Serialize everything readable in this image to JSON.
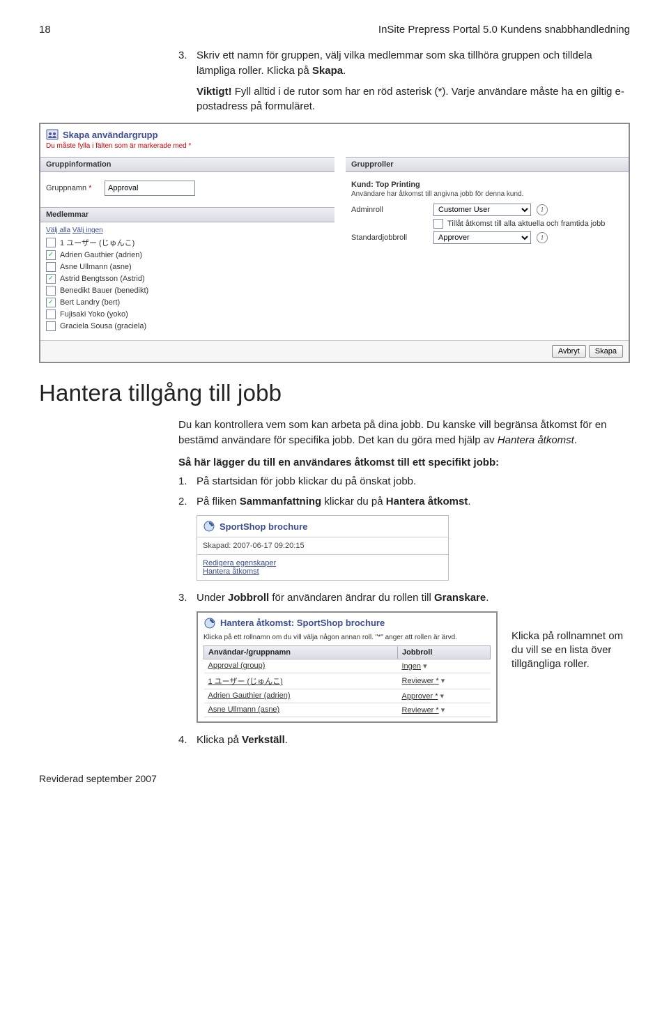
{
  "header": {
    "page_no": "18",
    "doc_title": "InSite Prepress Portal 5.0 Kundens snabbhandledning"
  },
  "intro": {
    "step3_num": "3.",
    "step3_text_a": "Skriv ett namn för gruppen, välj vilka medlemmar som ska tillhöra gruppen och tilldela lämpliga roller. Klicka på ",
    "step3_text_bold": "Skapa",
    "step3_text_b": ".",
    "viktigt_label": "Viktigt!",
    "viktigt_text": " Fyll alltid i de rutor som har en röd asterisk (*). Varje användare måste ha en giltig e-postadress på formuläret."
  },
  "panel1": {
    "title": "Skapa användargrupp",
    "required": "Du måste fylla i fälten som är markerade med *",
    "sec_gruppinfo": "Gruppinformation",
    "sec_grupproller": "Grupproller",
    "gruppnamn_label": "Gruppnamn",
    "gruppnamn_value": "Approval",
    "medlemmar_label": "Medlemmar",
    "valj_alla": "Välj alla",
    "valj_ingen": "Välj ingen",
    "members": [
      {
        "chk": false,
        "name": "1 ユーザー (じゅんこ)"
      },
      {
        "chk": true,
        "name": "Adrien Gauthier (adrien)"
      },
      {
        "chk": false,
        "name": "Asne Ullmann (asne)"
      },
      {
        "chk": true,
        "name": "Astrid Bengtsson (Astrid)"
      },
      {
        "chk": false,
        "name": "Benedikt Bauer (benedikt)"
      },
      {
        "chk": true,
        "name": "Bert Landry (bert)"
      },
      {
        "chk": false,
        "name": "Fujisaki Yoko (yoko)"
      },
      {
        "chk": false,
        "name": "Graciela Sousa (graciela)"
      }
    ],
    "kund_label": "Kund: Top Printing",
    "kund_note": "Användare har åtkomst till angivna jobb för denna kund.",
    "adminroll_label": "Adminroll",
    "adminroll_value": "Customer User",
    "tillat_label": "Tillåt åtkomst till alla aktuella och framtida jobb",
    "stdjobbroll_label": "Standardjobbroll",
    "stdjobbroll_value": "Approver",
    "btn_cancel": "Avbryt",
    "btn_create": "Skapa"
  },
  "section": {
    "heading": "Hantera tillgång till jobb",
    "p1_a": "Du kan kontrollera vem som kan arbeta på dina jobb. Du kanske vill begränsa åtkomst för en bestämd användare för specifika jobb. Det kan du göra med hjälp av ",
    "p1_italic": "Hantera åtkomst",
    "p1_b": ".",
    "howto": "Så här lägger du till en användares åtkomst till ett specifikt jobb:",
    "s1_num": "1.",
    "s1": "På startsidan för jobb klickar du på önskat jobb.",
    "s2_num": "2.",
    "s2_a": "På fliken ",
    "s2_bold1": "Sammanfattning",
    "s2_mid": " klickar du på ",
    "s2_bold2": "Hantera åtkomst",
    "s2_b": ".",
    "s3_num": "3.",
    "s3_a": "Under ",
    "s3_bold1": "Jobbroll",
    "s3_mid": " för användaren ändrar du rollen till ",
    "s3_bold2": "Granskare",
    "s3_b": ".",
    "s4_num": "4.",
    "s4_a": "Klicka på ",
    "s4_bold": "Verkställ",
    "s4_b": "."
  },
  "card": {
    "title": "SportShop brochure",
    "skapad": "Skapad: 2007-06-17 09:20:15",
    "link1": "Redigera egenskaper",
    "link2": "Hantera åtkomst"
  },
  "mpanel": {
    "title": "Hantera åtkomst: SportShop brochure",
    "desc": "Klicka på ett rollnamn om du vill välja någon annan roll. \"*\" anger att rollen är ärvd.",
    "col1": "Användar-/gruppnamn",
    "col2": "Jobbroll",
    "rows": [
      {
        "name": "Approval (group)",
        "role": "Ingen"
      },
      {
        "name": "1 ユーザー (じゅんこ)",
        "role": "Reviewer *"
      },
      {
        "name": "Adrien Gauthier (adrien)",
        "role": "Approver *"
      },
      {
        "name": "Asne Ullmann (asne)",
        "role": "Reviewer *"
      }
    ]
  },
  "annotation": "Klicka på rollnamnet om du vill se en lista över tillgängliga roller.",
  "footer": "Reviderad september 2007"
}
